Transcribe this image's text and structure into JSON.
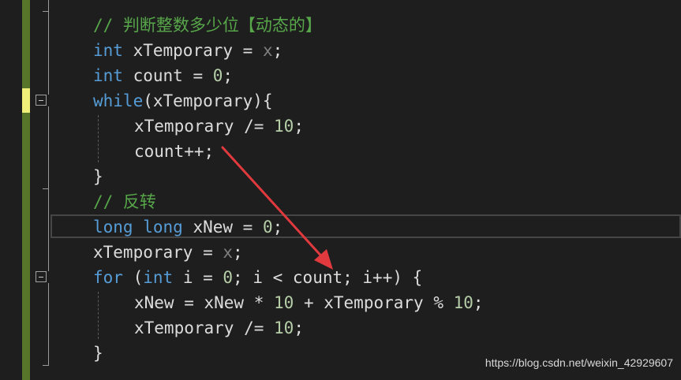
{
  "editor": {
    "lines": [
      {
        "indent": 0,
        "tokens": [
          {
            "t": "// 判断整数多少位【动态的】",
            "c": "cm"
          }
        ]
      },
      {
        "indent": 0,
        "tokens": [
          {
            "t": "int",
            "c": "kw"
          },
          {
            "t": " xTemporary = ",
            "c": "pl"
          },
          {
            "t": "x",
            "c": "gr"
          },
          {
            "t": ";",
            "c": "pl"
          }
        ]
      },
      {
        "indent": 0,
        "tokens": [
          {
            "t": "int",
            "c": "kw"
          },
          {
            "t": " count = ",
            "c": "pl"
          },
          {
            "t": "0",
            "c": "num"
          },
          {
            "t": ";",
            "c": "pl"
          }
        ]
      },
      {
        "indent": 0,
        "tokens": [
          {
            "t": "while",
            "c": "kw"
          },
          {
            "t": "(xTemporary){",
            "c": "pl"
          }
        ]
      },
      {
        "indent": 1,
        "tokens": [
          {
            "t": "xTemporary /= ",
            "c": "pl"
          },
          {
            "t": "10",
            "c": "num"
          },
          {
            "t": ";",
            "c": "pl"
          }
        ]
      },
      {
        "indent": 1,
        "tokens": [
          {
            "t": "count++;",
            "c": "pl"
          }
        ]
      },
      {
        "indent": 0,
        "tokens": [
          {
            "t": "}",
            "c": "pl"
          }
        ]
      },
      {
        "indent": 0,
        "tokens": [
          {
            "t": "// 反转",
            "c": "cm"
          }
        ]
      },
      {
        "indent": 0,
        "tokens": [
          {
            "t": "long",
            "c": "kw"
          },
          {
            "t": " ",
            "c": "pl"
          },
          {
            "t": "long",
            "c": "kw"
          },
          {
            "t": " xNew = ",
            "c": "pl"
          },
          {
            "t": "0",
            "c": "num"
          },
          {
            "t": ";",
            "c": "pl"
          }
        ]
      },
      {
        "indent": 0,
        "tokens": [
          {
            "t": "xTemporary = ",
            "c": "pl"
          },
          {
            "t": "x",
            "c": "gr"
          },
          {
            "t": ";",
            "c": "pl"
          }
        ]
      },
      {
        "indent": 0,
        "tokens": [
          {
            "t": "for",
            "c": "kw"
          },
          {
            "t": " (",
            "c": "pl"
          },
          {
            "t": "int",
            "c": "kw"
          },
          {
            "t": " i = ",
            "c": "pl"
          },
          {
            "t": "0",
            "c": "num"
          },
          {
            "t": "; i < count; i++) {",
            "c": "pl"
          }
        ]
      },
      {
        "indent": 1,
        "tokens": [
          {
            "t": "xNew = xNew * ",
            "c": "pl"
          },
          {
            "t": "10",
            "c": "num"
          },
          {
            "t": " + xTemporary % ",
            "c": "pl"
          },
          {
            "t": "10",
            "c": "num"
          },
          {
            "t": ";",
            "c": "pl"
          }
        ]
      },
      {
        "indent": 1,
        "tokens": [
          {
            "t": "xTemporary /= ",
            "c": "pl"
          },
          {
            "t": "10",
            "c": "num"
          },
          {
            "t": ";",
            "c": "pl"
          }
        ]
      },
      {
        "indent": 0,
        "tokens": [
          {
            "t": "}",
            "c": "pl"
          }
        ]
      }
    ],
    "current_line_index": 8,
    "colors": {
      "background": "#1e1e1e",
      "keyword": "#569cd6",
      "comment": "#57a64a",
      "number": "#b5cea8",
      "gray_identifier": "#7f7f7f",
      "text": "#dcdcdc",
      "gutter_green": "#57762a",
      "gutter_modified": "#efef7a",
      "annotation_arrow": "#e0393e"
    }
  },
  "gutter": {
    "fold_icons": [
      "collapse-icon",
      "collapse-icon"
    ]
  },
  "annotation": {
    "icon": "red-arrow-icon"
  },
  "watermark": "https://blog.csdn.net/weixin_42929607"
}
